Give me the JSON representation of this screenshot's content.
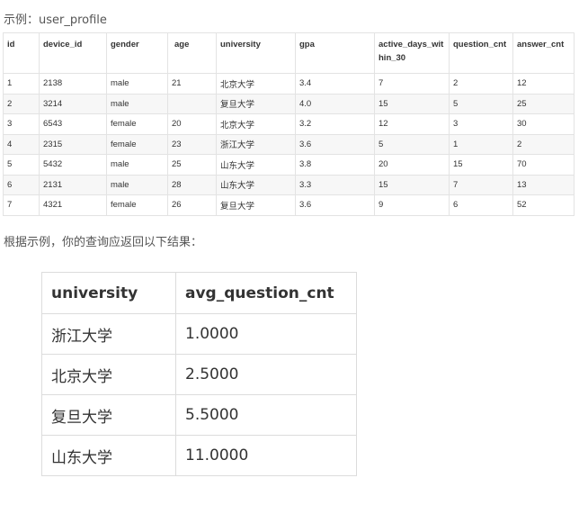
{
  "example_caption": "示例：user_profile",
  "example_table": {
    "headers": [
      "id",
      "device_id",
      "gender",
      "age",
      "university",
      "gpa",
      "active_days_within_30",
      "question_cnt",
      "answer_cnt"
    ],
    "rows": [
      [
        "1",
        "2138",
        "male",
        "21",
        "北京大学",
        "3.4",
        "7",
        "2",
        "12"
      ],
      [
        "2",
        "3214",
        "male",
        "",
        "复旦大学",
        "4.0",
        "15",
        "5",
        "25"
      ],
      [
        "3",
        "6543",
        "female",
        "20",
        "北京大学",
        "3.2",
        "12",
        "3",
        "30"
      ],
      [
        "4",
        "2315",
        "female",
        "23",
        "浙江大学",
        "3.6",
        "5",
        "1",
        "2"
      ],
      [
        "5",
        "5432",
        "male",
        "25",
        "山东大学",
        "3.8",
        "20",
        "15",
        "70"
      ],
      [
        "6",
        "2131",
        "male",
        "28",
        "山东大学",
        "3.3",
        "15",
        "7",
        "13"
      ],
      [
        "7",
        "4321",
        "female",
        "26",
        "复旦大学",
        "3.6",
        "9",
        "6",
        "52"
      ]
    ]
  },
  "result_caption": "根据示例，你的查询应返回以下结果：",
  "result_table": {
    "headers": [
      "university",
      "avg_question_cnt"
    ],
    "rows": [
      [
        "浙江大学",
        "1.0000"
      ],
      [
        "北京大学",
        "2.5000"
      ],
      [
        "复旦大学",
        "5.5000"
      ],
      [
        "山东大学",
        "11.0000"
      ]
    ]
  }
}
